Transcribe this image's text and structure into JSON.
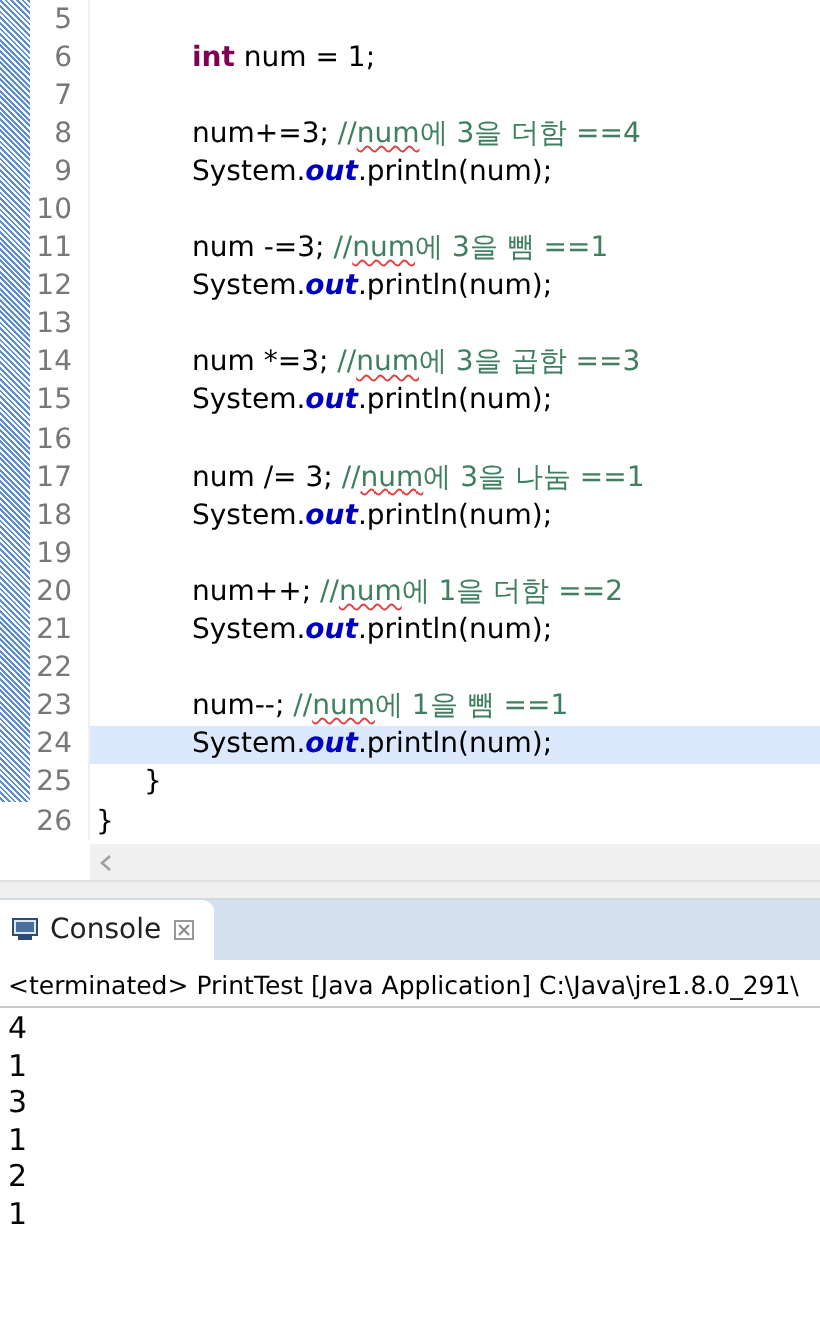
{
  "editor": {
    "lines": [
      {
        "number": "5",
        "current": false
      },
      {
        "number": "6",
        "current": false,
        "segments": [
          {
            "kind": "keyword",
            "text": "int"
          },
          {
            "kind": "plain",
            "text": " num = 1;"
          }
        ]
      },
      {
        "number": "7",
        "current": false
      },
      {
        "number": "8",
        "current": false,
        "segments": [
          {
            "kind": "plain",
            "text": "num+=3; "
          },
          {
            "kind": "comment",
            "text": "//"
          },
          {
            "kind": "spell",
            "text": "num"
          },
          {
            "kind": "comment",
            "text": "에 3을 더함 ==4"
          }
        ]
      },
      {
        "number": "9",
        "current": false,
        "segments": [
          {
            "kind": "plain",
            "text": "System."
          },
          {
            "kind": "field",
            "text": "out"
          },
          {
            "kind": "plain",
            "text": ".println(num);"
          }
        ]
      },
      {
        "number": "10",
        "current": false
      },
      {
        "number": "11",
        "current": false,
        "segments": [
          {
            "kind": "plain",
            "text": "num -=3; "
          },
          {
            "kind": "comment",
            "text": "//"
          },
          {
            "kind": "spell",
            "text": "num"
          },
          {
            "kind": "comment",
            "text": "에 3을 뺌 ==1"
          }
        ]
      },
      {
        "number": "12",
        "current": false,
        "segments": [
          {
            "kind": "plain",
            "text": "System."
          },
          {
            "kind": "field",
            "text": "out"
          },
          {
            "kind": "plain",
            "text": ".println(num);"
          }
        ]
      },
      {
        "number": "13",
        "current": false
      },
      {
        "number": "14",
        "current": false,
        "segments": [
          {
            "kind": "plain",
            "text": "num *=3; "
          },
          {
            "kind": "comment",
            "text": "//"
          },
          {
            "kind": "spell",
            "text": "num"
          },
          {
            "kind": "comment",
            "text": "에 3을 곱함 ==3"
          }
        ]
      },
      {
        "number": "15",
        "current": false,
        "segments": [
          {
            "kind": "plain",
            "text": "System."
          },
          {
            "kind": "field",
            "text": "out"
          },
          {
            "kind": "plain",
            "text": ".println(num);"
          }
        ]
      },
      {
        "number": "16",
        "current": false
      },
      {
        "number": "17",
        "current": false,
        "segments": [
          {
            "kind": "plain",
            "text": "num /= 3; "
          },
          {
            "kind": "comment",
            "text": "//"
          },
          {
            "kind": "spell",
            "text": "num"
          },
          {
            "kind": "comment",
            "text": "에 3을 나눔 ==1"
          }
        ]
      },
      {
        "number": "18",
        "current": false,
        "segments": [
          {
            "kind": "plain",
            "text": "System."
          },
          {
            "kind": "field",
            "text": "out"
          },
          {
            "kind": "plain",
            "text": ".println(num);"
          }
        ]
      },
      {
        "number": "19",
        "current": false
      },
      {
        "number": "20",
        "current": false,
        "segments": [
          {
            "kind": "plain",
            "text": "num++; "
          },
          {
            "kind": "comment",
            "text": "//"
          },
          {
            "kind": "spell",
            "text": "num"
          },
          {
            "kind": "comment",
            "text": "에 1을 더함 ==2"
          }
        ]
      },
      {
        "number": "21",
        "current": false,
        "segments": [
          {
            "kind": "plain",
            "text": "System."
          },
          {
            "kind": "field",
            "text": "out"
          },
          {
            "kind": "plain",
            "text": ".println(num);"
          }
        ]
      },
      {
        "number": "22",
        "current": false
      },
      {
        "number": "23",
        "current": false,
        "segments": [
          {
            "kind": "plain",
            "text": "num--; "
          },
          {
            "kind": "comment",
            "text": "//"
          },
          {
            "kind": "spell",
            "text": "num"
          },
          {
            "kind": "comment",
            "text": "에 1을 뺌 ==1"
          }
        ]
      },
      {
        "number": "24",
        "current": true,
        "segments": [
          {
            "kind": "plain",
            "text": "System."
          },
          {
            "kind": "field",
            "text": "out"
          },
          {
            "kind": "plain",
            "text": ".println(num);"
          }
        ]
      },
      {
        "number": "25",
        "current": false,
        "kind": "method_end",
        "segments": [
          {
            "kind": "plain",
            "text": "}"
          }
        ]
      },
      {
        "number": "26",
        "current": false,
        "kind": "class_end",
        "segments": [
          {
            "kind": "plain",
            "text": "}"
          }
        ]
      }
    ]
  },
  "console": {
    "tab": {
      "label": "Console",
      "selected": true
    },
    "status": "<terminated> PrintTest [Java Application] C:\\Java\\jre1.8.0_291\\",
    "output": [
      "4",
      "1",
      "3",
      "1",
      "2",
      "1"
    ]
  }
}
